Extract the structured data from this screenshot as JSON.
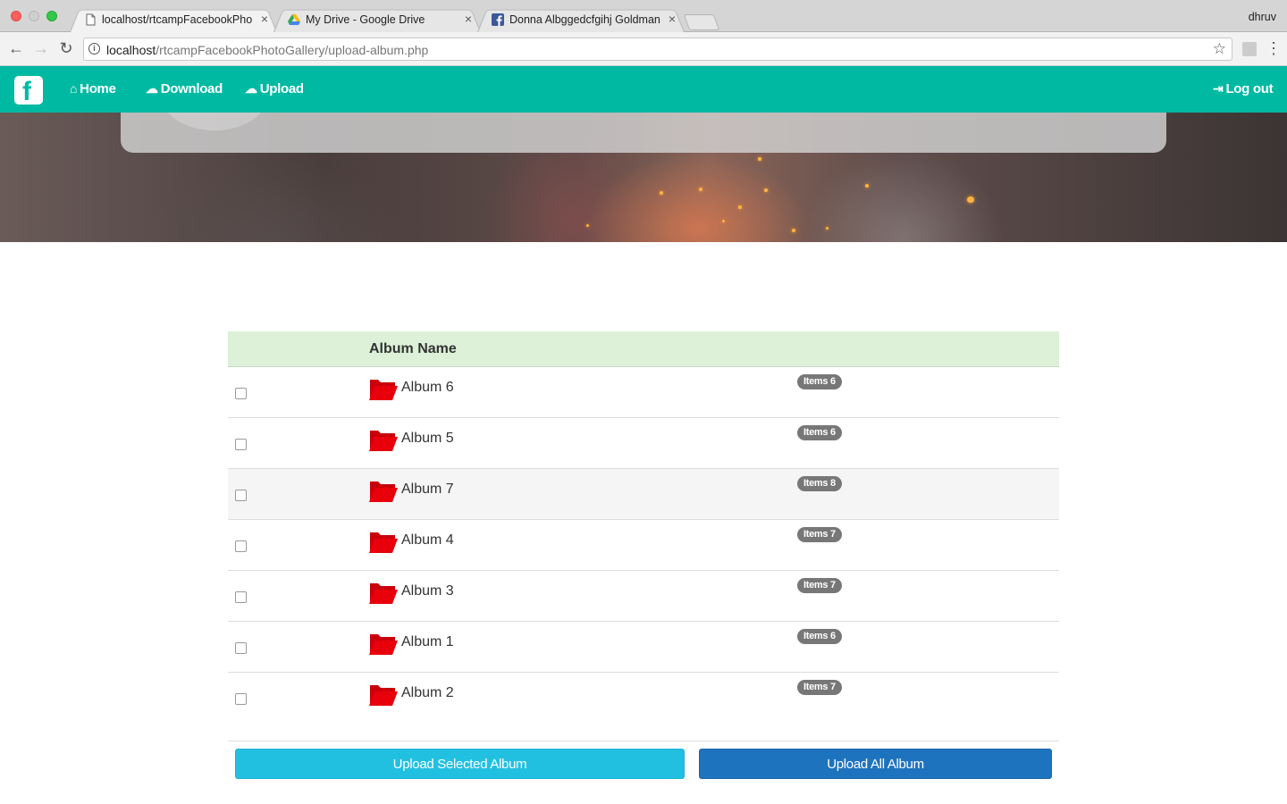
{
  "browser": {
    "tabs": [
      {
        "title": "localhost/rtcampFacebookPho",
        "close": "×"
      },
      {
        "title": "My Drive - Google Drive",
        "close": "×"
      },
      {
        "title": "Donna Albggedcfgihj Goldman",
        "close": "×"
      }
    ],
    "profile": "dhruv",
    "url_host": "localhost",
    "url_path": "/rtcampFacebookPhotoGallery/upload-album.php"
  },
  "nav": {
    "home": "Home",
    "download": "Download",
    "upload": "Upload",
    "logout": "Log out"
  },
  "table": {
    "header_name": "Album Name",
    "albums": [
      {
        "name": "Album 6",
        "badge": "Items 6"
      },
      {
        "name": "Album 5",
        "badge": "Items 6"
      },
      {
        "name": "Album 7",
        "badge": "Items 8"
      },
      {
        "name": "Album 4",
        "badge": "Items 7"
      },
      {
        "name": "Album 3",
        "badge": "Items 7"
      },
      {
        "name": "Album 1",
        "badge": "Items 6"
      },
      {
        "name": "Album 2",
        "badge": "Items 7"
      }
    ]
  },
  "buttons": {
    "upload_selected": "Upload Selected Album",
    "upload_all": "Upload All Album"
  },
  "colors": {
    "navbar": "#00b9a2",
    "table_header": "#dcf1d8",
    "badge": "#777777",
    "folder": "#e8000b",
    "upload_selected": "#22c0e0",
    "upload_all": "#1e73be"
  }
}
